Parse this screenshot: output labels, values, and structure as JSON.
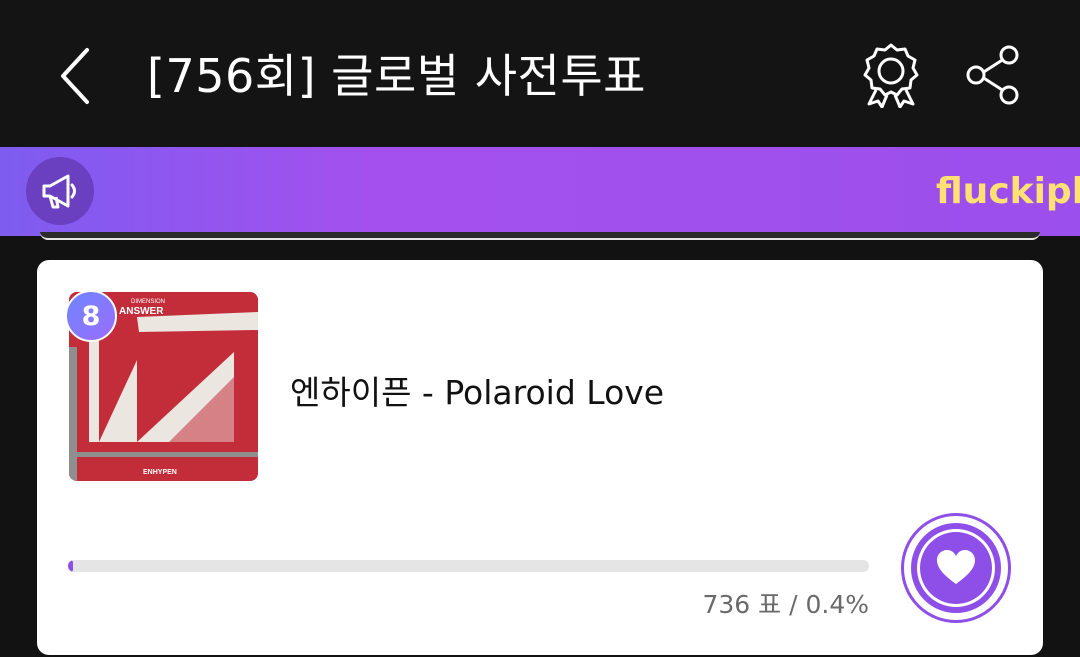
{
  "header": {
    "title": "[756회] 글로벌 사전투표",
    "icons": {
      "back": "chevron-left-icon",
      "badge": "award-badge-icon",
      "share": "share-icon"
    }
  },
  "notice": {
    "icon": "megaphone-icon",
    "text": "fluckiph"
  },
  "entry": {
    "rank": "8",
    "song": "엔하이픈 - Polaroid Love",
    "album_art": {
      "series_label": "DIMENSION",
      "title_label": "ANSWER",
      "artist_label": "ENHYPEN"
    },
    "vote_progress_percent": 0.4,
    "vote_stats": "736 표 / 0.4%",
    "vote_icon": "heart-icon"
  },
  "colors": {
    "accent": "#8e4fe8",
    "notice_text": "#ffe073",
    "album_red": "#c32d3a"
  }
}
